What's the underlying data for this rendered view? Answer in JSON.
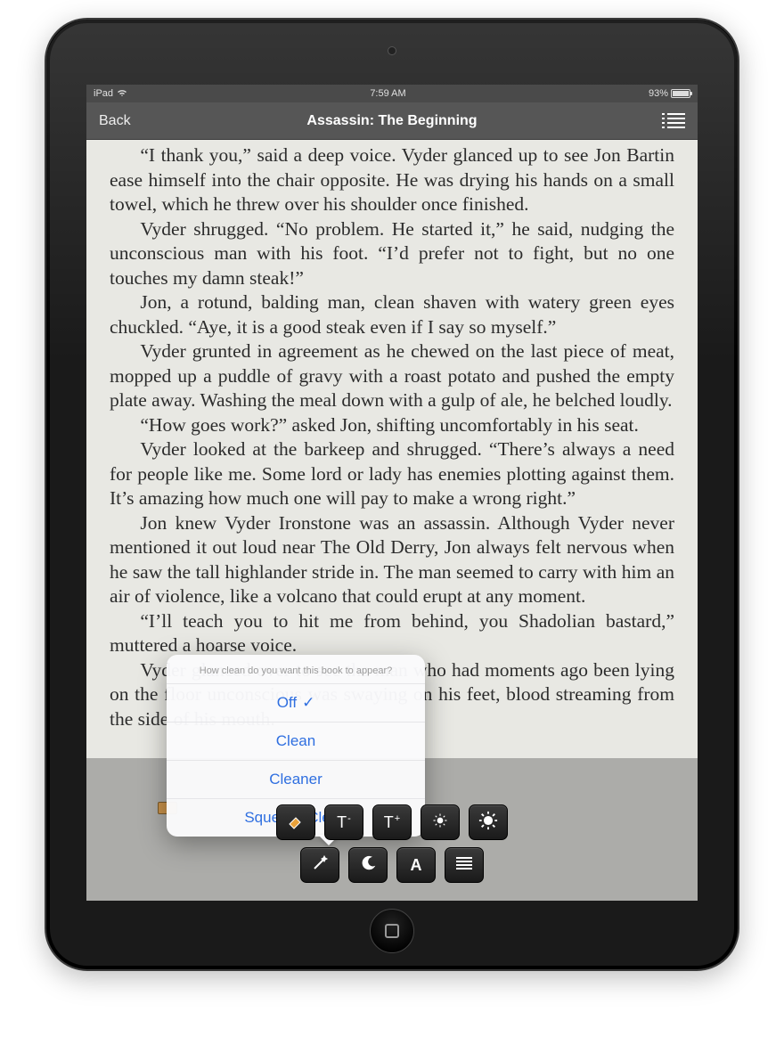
{
  "status": {
    "carrier": "iPad",
    "time": "7:59 AM",
    "battery_pct": "93%"
  },
  "nav": {
    "back_label": "Back",
    "title": "Assassin: The Beginning"
  },
  "paragraphs": [
    "“I thank you,” said a deep voice. Vyder glanced up to see Jon Bartin ease himself into the chair opposite. He was drying his hands on a small towel, which he threw over his shoulder once finished.",
    "Vyder shrugged. “No problem. He started it,” he said, nudging the unconscious man with his foot. “I’d prefer not to fight, but no one touches my damn steak!”",
    "Jon, a rotund, balding man, clean shaven with watery green eyes chuckled. “Aye, it is a good steak even if I say so myself.”",
    "Vyder grunted in agreement as he chewed on the last piece of meat, mopped up a puddle of gravy with a roast potato and pushed the empty plate away. Washing the meal down with a gulp of ale, he belched loudly.",
    "“How goes work?” asked Jon, shifting uncomfortably in his seat.",
    "Vyder looked at the barkeep and shrugged. “There’s always a need for people like me. Some lord or lady has enemies plotting against them. It’s amazing how much one will pay to make a wrong right.”",
    "Jon knew Vyder Ironstone was an assassin. Although Vyder never mentioned it out loud near The Old Derry, Jon always felt nervous when he saw the tall highlander stride in. The man seemed to carry with him an air of violence, like a volcano that could erupt at any moment.",
    "“I’ll teach you to hit me from behind, you Shadolian bastard,” muttered a hoarse voice.",
    "Vyder glanced over to see the man who had moments ago been lying on the floor unconscious was swaying on his feet, blood streaming from the side of his mouth."
  ],
  "popover": {
    "title": "How clean do you want this book to appear?",
    "options": [
      "Off",
      "Clean",
      "Cleaner",
      "Squeaky Clean"
    ],
    "selected_index": 0
  },
  "toolbar": {
    "row1": {
      "clean": "clean-filter",
      "font_smaller": "T-",
      "font_larger": "T+",
      "brightness_down": "brightness-down",
      "brightness_up": "brightness-up"
    },
    "row2": {
      "magic": "magic-wand",
      "night": "night-mode",
      "font": "A",
      "justify": "justify"
    }
  }
}
